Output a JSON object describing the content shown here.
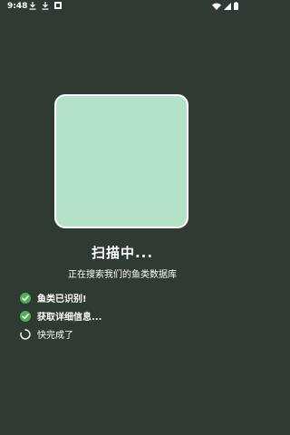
{
  "status_bar": {
    "time": "9:48",
    "left_icons": [
      "download-icon",
      "download-icon",
      "notification-square-icon"
    ],
    "right_icons": [
      "wifi-icon",
      "signal-icon",
      "battery-icon"
    ]
  },
  "scan": {
    "title": "扫描中...",
    "subtitle": "正在搜索我们的鱼类数据库",
    "preview_color": "#b4e2c8"
  },
  "steps": [
    {
      "label": "鱼类已识别!",
      "state": "done",
      "icon": "check-circle-icon"
    },
    {
      "label": "获取详细信息...",
      "state": "done",
      "icon": "check-circle-icon"
    },
    {
      "label": "快完成了",
      "state": "loading",
      "icon": "spinner-icon"
    }
  ],
  "colors": {
    "background": "#2f3a33",
    "accent": "#4caf50",
    "text": "#ffffff"
  }
}
